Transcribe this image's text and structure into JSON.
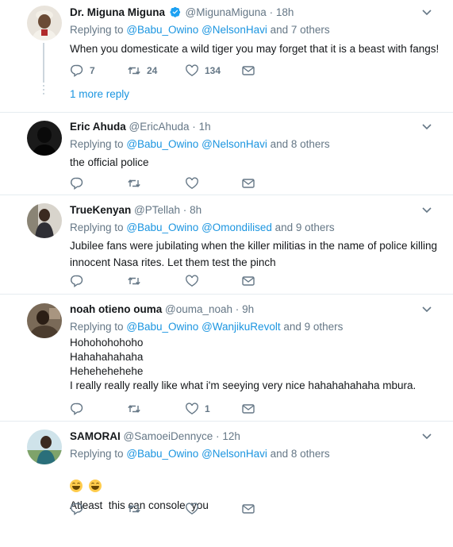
{
  "tweets": [
    {
      "name": "Dr. Miguna Miguna",
      "handle": "@MigunaMiguna",
      "time": "18h",
      "verified": true,
      "reply_prefix": "Replying to",
      "mention1": "@Babu_Owino",
      "mention2": "@NelsonHavi",
      "reply_suffix": "and 7 others",
      "lines": [
        "When you domesticate a wild tiger you may forget that it is a beast with fangs!"
      ],
      "replies": "7",
      "retweets": "24",
      "likes": "134",
      "more_reply": "1 more reply"
    },
    {
      "name": "Eric Ahuda",
      "handle": "@EricAhuda",
      "time": "1h",
      "reply_prefix": "Replying to",
      "mention1": "@Babu_Owino",
      "mention2": "@NelsonHavi",
      "reply_suffix": "and 8 others",
      "lines": [
        "the official police"
      ]
    },
    {
      "name": "TrueKenyan",
      "handle": "@PTellah",
      "time": "8h",
      "reply_prefix": "Replying to",
      "mention1": "@Babu_Owino",
      "mention2": "@Omondilised",
      "reply_suffix": "and 9 others",
      "lines": [
        "Jubilee fans were jubilating when the killer militias in the name of police killing",
        "innocent Nasa rites. Let them test the pinch"
      ]
    },
    {
      "name": "noah otieno ouma",
      "handle": "@ouma_noah",
      "time": "9h",
      "reply_prefix": "Replying to",
      "mention1": "@Babu_Owino",
      "mention2": "@WanjikuRevolt",
      "reply_suffix": "and 9 others",
      "lines": [
        "Hohohohohoho",
        "Hahahahahaha",
        "Hehehehehehe",
        "I really really really like what i'm seeying very nice hahahahahaha mbura."
      ],
      "likes": "1"
    },
    {
      "name": "SAMORAI",
      "handle": "@SamoeiDennyce",
      "time": "12h",
      "reply_prefix": "Replying to",
      "mention1": "@Babu_Owino",
      "mention2": "@NelsonHavi",
      "reply_suffix": "and 8 others",
      "lines": [
        "Atleast  this can console  you"
      ],
      "emojis": [
        "grinning-face-emoji",
        "grinning-face-emoji"
      ]
    }
  ],
  "colors": {
    "link": "#1b95e0",
    "muted": "#657786",
    "text": "#14171a",
    "verified": "#1da1f2",
    "divider": "#e6ecf0"
  },
  "icons": [
    "reply-icon",
    "retweet-icon",
    "like-icon",
    "message-icon",
    "caret-down-icon",
    "verified-badge-icon"
  ]
}
